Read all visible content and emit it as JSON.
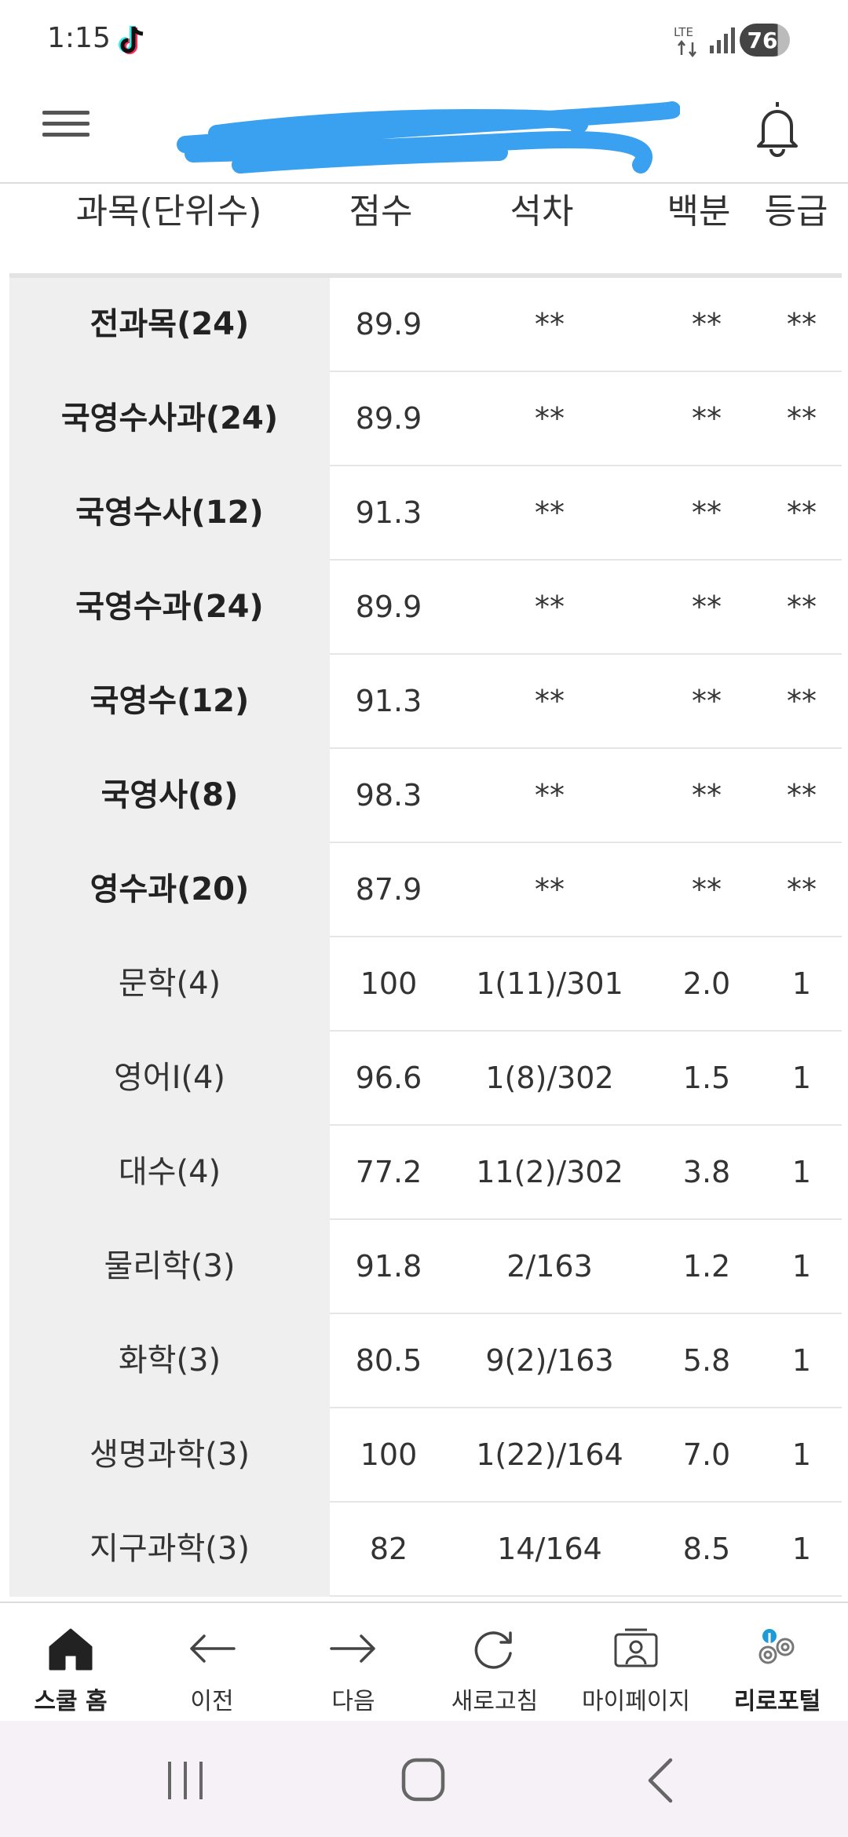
{
  "status_bar": {
    "time": "1:15",
    "network": "LTE",
    "battery": "76"
  },
  "header": {
    "menu_icon": "hamburger-icon",
    "notification_icon": "bell-icon"
  },
  "columns": {
    "subject": "과목(단위수)",
    "score": "점수",
    "rank": "석차",
    "percent": "백분",
    "grade": "등급"
  },
  "rows": [
    {
      "subject": "전과목(24)",
      "score": "89.9",
      "rank": "**",
      "percent": "**",
      "grade": "**"
    },
    {
      "subject": "국영수사과(24)",
      "score": "89.9",
      "rank": "**",
      "percent": "**",
      "grade": "**"
    },
    {
      "subject": "국영수사(12)",
      "score": "91.3",
      "rank": "**",
      "percent": "**",
      "grade": "**"
    },
    {
      "subject": "국영수과(24)",
      "score": "89.9",
      "rank": "**",
      "percent": "**",
      "grade": "**"
    },
    {
      "subject": "국영수(12)",
      "score": "91.3",
      "rank": "**",
      "percent": "**",
      "grade": "**"
    },
    {
      "subject": "국영사(8)",
      "score": "98.3",
      "rank": "**",
      "percent": "**",
      "grade": "**"
    },
    {
      "subject": "영수과(20)",
      "score": "87.9",
      "rank": "**",
      "percent": "**",
      "grade": "**"
    },
    {
      "subject": "문학(4)",
      "score": "100",
      "rank": "1(11)/301",
      "percent": "2.0",
      "grade": "1"
    },
    {
      "subject": "영어I(4)",
      "score": "96.6",
      "rank": "1(8)/302",
      "percent": "1.5",
      "grade": "1"
    },
    {
      "subject": "대수(4)",
      "score": "77.2",
      "rank": "11(2)/302",
      "percent": "3.8",
      "grade": "1"
    },
    {
      "subject": "물리학(3)",
      "score": "91.8",
      "rank": "2/163",
      "percent": "1.2",
      "grade": "1"
    },
    {
      "subject": "화학(3)",
      "score": "80.5",
      "rank": "9(2)/163",
      "percent": "5.8",
      "grade": "1"
    },
    {
      "subject": "생명과학(3)",
      "score": "100",
      "rank": "1(22)/164",
      "percent": "7.0",
      "grade": "1"
    },
    {
      "subject": "지구과학(3)",
      "score": "82",
      "rank": "14/164",
      "percent": "8.5",
      "grade": "1"
    }
  ],
  "bottom_nav": [
    {
      "label": "스쿨 홈",
      "icon": "home-icon"
    },
    {
      "label": "이전",
      "icon": "arrow-left-icon"
    },
    {
      "label": "다음",
      "icon": "arrow-right-icon"
    },
    {
      "label": "새로고침",
      "icon": "refresh-icon"
    },
    {
      "label": "마이페이지",
      "icon": "profile-card-icon"
    },
    {
      "label": "리로포털",
      "icon": "riro-portal-icon"
    }
  ],
  "colors": {
    "subject_bg": "#efefef",
    "redaction": "#3aa0f0",
    "riro_blue": "#1a9ad6"
  }
}
